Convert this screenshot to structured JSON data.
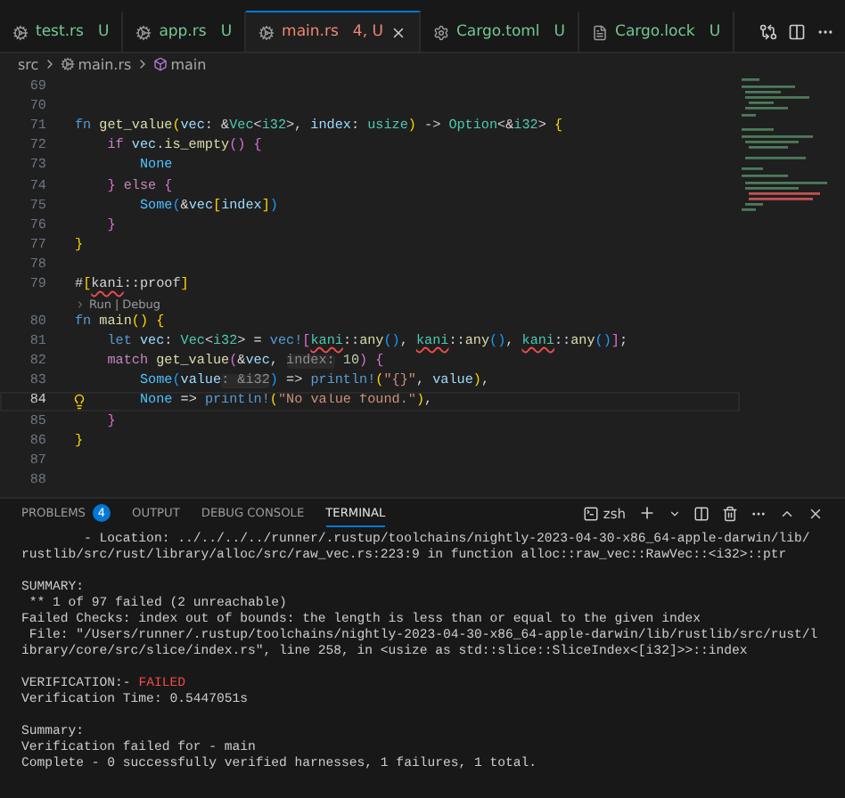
{
  "tabs": [
    {
      "label": "test.rs",
      "kind": "rust",
      "badge": "U",
      "color": "#73c991",
      "selected": false
    },
    {
      "label": "app.rs",
      "kind": "rust",
      "badge": "U",
      "color": "#73c991",
      "selected": false
    },
    {
      "label": "main.rs",
      "kind": "rust",
      "badge": "4, U",
      "color": "#f48771",
      "selected": true
    },
    {
      "label": "Cargo.toml",
      "kind": "config",
      "badge": "U",
      "color": "#73c991",
      "selected": false
    },
    {
      "label": "Cargo.lock",
      "kind": "lock",
      "badge": "U",
      "color": "#73c991",
      "selected": false
    }
  ],
  "breadcrumb": [
    {
      "label": "src",
      "kind": "folder"
    },
    {
      "label": "main.rs",
      "kind": "rust"
    },
    {
      "label": "main",
      "kind": "symbol"
    }
  ],
  "editor": {
    "lines": [
      {
        "kind": "code",
        "number": "69",
        "current": false,
        "lightbulb": false
      },
      {
        "kind": "code",
        "number": "70",
        "current": false,
        "lightbulb": false
      },
      {
        "kind": "code",
        "number": "71",
        "current": false,
        "lightbulb": false,
        "tokens": [
          {
            "text": "fn ",
            "kind": "kw"
          },
          {
            "text": "get_value",
            "kind": "func"
          },
          {
            "text": "(",
            "kind": "br1"
          },
          {
            "text": "vec",
            "kind": "var"
          },
          {
            "text": ": &",
            "kind": "punct"
          },
          {
            "text": "Vec",
            "kind": "type"
          },
          {
            "text": "<",
            "kind": "punct"
          },
          {
            "text": "i32",
            "kind": "type"
          },
          {
            "text": ">, ",
            "kind": "punct"
          },
          {
            "text": "index",
            "kind": "var"
          },
          {
            "text": ": ",
            "kind": "punct"
          },
          {
            "text": "usize",
            "kind": "type"
          },
          {
            "text": ")",
            "kind": "br1"
          },
          {
            "text": " -> ",
            "kind": "punct"
          },
          {
            "text": "Option",
            "kind": "type"
          },
          {
            "text": "<&",
            "kind": "punct"
          },
          {
            "text": "i32",
            "kind": "type"
          },
          {
            "text": "> ",
            "kind": "punct"
          },
          {
            "text": "{",
            "kind": "br1"
          }
        ]
      },
      {
        "kind": "code",
        "number": "72",
        "current": false,
        "lightbulb": false,
        "tokens": [
          {
            "text": "    if ",
            "kind": "ctrl"
          },
          {
            "text": "vec",
            "kind": "var"
          },
          {
            "text": ".",
            "kind": "punct"
          },
          {
            "text": "is_empty",
            "kind": "func"
          },
          {
            "text": "()",
            "kind": "br2"
          },
          {
            "text": " {",
            "kind": "br2"
          }
        ]
      },
      {
        "kind": "code",
        "number": "73",
        "current": false,
        "lightbulb": false,
        "tokens": [
          {
            "text": "        None",
            "kind": "enum"
          }
        ]
      },
      {
        "kind": "code",
        "number": "74",
        "current": false,
        "lightbulb": false,
        "tokens": [
          {
            "text": "    } ",
            "kind": "br2"
          },
          {
            "text": "else ",
            "kind": "ctrl"
          },
          {
            "text": "{",
            "kind": "br2"
          }
        ]
      },
      {
        "kind": "code",
        "number": "75",
        "current": false,
        "lightbulb": false,
        "tokens": [
          {
            "text": "        Some",
            "kind": "enum"
          },
          {
            "text": "(",
            "kind": "br3"
          },
          {
            "text": "&",
            "kind": "punct"
          },
          {
            "text": "vec",
            "kind": "var"
          },
          {
            "text": "[",
            "kind": "br1"
          },
          {
            "text": "index",
            "kind": "var"
          },
          {
            "text": "]",
            "kind": "br1"
          },
          {
            "text": ")",
            "kind": "br3"
          }
        ]
      },
      {
        "kind": "code",
        "number": "76",
        "current": false,
        "lightbulb": false,
        "tokens": [
          {
            "text": "    }",
            "kind": "br2"
          }
        ]
      },
      {
        "kind": "code",
        "number": "77",
        "current": false,
        "lightbulb": false,
        "tokens": [
          {
            "text": "}",
            "kind": "br1"
          }
        ]
      },
      {
        "kind": "code",
        "number": "78",
        "current": false,
        "lightbulb": false
      },
      {
        "kind": "code",
        "number": "79",
        "current": false,
        "lightbulb": false,
        "tokens": [
          {
            "text": "#",
            "kind": "punct"
          },
          {
            "text": "[",
            "kind": "br1"
          },
          {
            "text": "kani",
            "kind": "punct",
            "squiggle": true
          },
          {
            "text": "::proof",
            "kind": "punct"
          },
          {
            "text": "]",
            "kind": "br1"
          }
        ]
      },
      {
        "kind": "codelens",
        "links": [
          "Run",
          "Debug"
        ],
        "separator": "|"
      },
      {
        "kind": "code",
        "number": "80",
        "current": false,
        "lightbulb": false,
        "tokens": [
          {
            "text": "fn ",
            "kind": "kw"
          },
          {
            "text": "main",
            "kind": "func"
          },
          {
            "text": "()",
            "kind": "br1"
          },
          {
            "text": " {",
            "kind": "br1"
          }
        ]
      },
      {
        "kind": "code",
        "number": "81",
        "current": false,
        "lightbulb": false,
        "tokens": [
          {
            "text": "    let ",
            "kind": "kw"
          },
          {
            "text": "vec",
            "kind": "var"
          },
          {
            "text": ": ",
            "kind": "punct"
          },
          {
            "text": "Vec",
            "kind": "type"
          },
          {
            "text": "<",
            "kind": "punct"
          },
          {
            "text": "i32",
            "kind": "type"
          },
          {
            "text": "> = ",
            "kind": "punct"
          },
          {
            "text": "vec!",
            "kind": "macro"
          },
          {
            "text": "[",
            "kind": "br2"
          },
          {
            "text": "kani",
            "kind": "type",
            "squiggle": true
          },
          {
            "text": "::",
            "kind": "punct"
          },
          {
            "text": "any",
            "kind": "func"
          },
          {
            "text": "()",
            "kind": "br3"
          },
          {
            "text": ", ",
            "kind": "punct"
          },
          {
            "text": "kani",
            "kind": "type",
            "squiggle": true
          },
          {
            "text": "::",
            "kind": "punct"
          },
          {
            "text": "any",
            "kind": "func"
          },
          {
            "text": "()",
            "kind": "br3"
          },
          {
            "text": ", ",
            "kind": "punct"
          },
          {
            "text": "kani",
            "kind": "type",
            "squiggle": true
          },
          {
            "text": "::",
            "kind": "punct"
          },
          {
            "text": "any",
            "kind": "func"
          },
          {
            "text": "()",
            "kind": "br3"
          },
          {
            "text": "]",
            "kind": "br2"
          },
          {
            "text": ";",
            "kind": "punct"
          }
        ]
      },
      {
        "kind": "code",
        "number": "82",
        "current": false,
        "lightbulb": false,
        "tokens": [
          {
            "text": "    match ",
            "kind": "ctrl"
          },
          {
            "text": "get_value",
            "kind": "func"
          },
          {
            "text": "(",
            "kind": "br2"
          },
          {
            "text": "&",
            "kind": "punct"
          },
          {
            "text": "vec",
            "kind": "var"
          },
          {
            "text": ", ",
            "kind": "punct"
          },
          {
            "text": "index:",
            "kind": "hint"
          },
          {
            "text": " 10",
            "kind": "num"
          },
          {
            "text": ")",
            "kind": "br2"
          },
          {
            "text": " {",
            "kind": "br2"
          }
        ]
      },
      {
        "kind": "code",
        "number": "83",
        "current": false,
        "lightbulb": false,
        "tokens": [
          {
            "text": "        Some",
            "kind": "enum"
          },
          {
            "text": "(",
            "kind": "br3"
          },
          {
            "text": "value",
            "kind": "var"
          },
          {
            "text": ": &i32",
            "kind": "hint"
          },
          {
            "text": ")",
            "kind": "br3"
          },
          {
            "text": " => ",
            "kind": "punct"
          },
          {
            "text": "println!",
            "kind": "macro"
          },
          {
            "text": "(",
            "kind": "br1"
          },
          {
            "text": "\"{}\"",
            "kind": "str"
          },
          {
            "text": ", ",
            "kind": "punct"
          },
          {
            "text": "value",
            "kind": "var"
          },
          {
            "text": ")",
            "kind": "br1"
          },
          {
            "text": ",",
            "kind": "punct"
          }
        ]
      },
      {
        "kind": "code",
        "number": "84",
        "current": true,
        "lightbulb": true,
        "tokens": [
          {
            "text": "        None",
            "kind": "enum"
          },
          {
            "text": " => ",
            "kind": "punct"
          },
          {
            "text": "println!",
            "kind": "macro"
          },
          {
            "text": "(",
            "kind": "br1"
          },
          {
            "text": "\"No value found.\"",
            "kind": "str"
          },
          {
            "text": ")",
            "kind": "br1"
          },
          {
            "text": ",",
            "kind": "punct"
          }
        ]
      },
      {
        "kind": "code",
        "number": "85",
        "current": false,
        "lightbulb": false,
        "tokens": [
          {
            "text": "    }",
            "kind": "br2"
          }
        ]
      },
      {
        "kind": "code",
        "number": "86",
        "current": false,
        "lightbulb": false,
        "tokens": [
          {
            "text": "}",
            "kind": "br1"
          }
        ]
      },
      {
        "kind": "code",
        "number": "87",
        "current": false,
        "lightbulb": false
      },
      {
        "kind": "code",
        "number": "88",
        "current": false,
        "lightbulb": false
      }
    ]
  },
  "panel": {
    "tabs": [
      {
        "label": "PROBLEMS",
        "badge": "4",
        "selected": false
      },
      {
        "label": "OUTPUT",
        "selected": false
      },
      {
        "label": "DEBUG CONSOLE",
        "selected": false
      },
      {
        "label": "TERMINAL",
        "selected": true
      }
    ],
    "shell": "zsh"
  },
  "terminal": {
    "blocks": [
      {
        "lines": [
          {
            "text": "        - Location: ../../../../runner/.rustup/toolchains/nightly-2023-04-30-x86_64-apple-darwin/lib/"
          },
          {
            "text": "rustlib/src/rust/library/alloc/src/raw_vec.rs:223:9 in function alloc::raw_vec::RawVec::<i32>::ptr"
          }
        ]
      },
      {
        "lines": [
          {
            "text": "SUMMARY:"
          },
          {
            "text": " ** 1 of 97 failed (2 unreachable)"
          },
          {
            "text": "Failed Checks: index out of bounds: the length is less than or equal to the given index"
          },
          {
            "text": " File: \"/Users/runner/.rustup/toolchains/nightly-2023-04-30-x86_64-apple-darwin/lib/rustlib/src/rust/l"
          },
          {
            "text": "ibrary/core/src/slice/index.rs\", line 258, in <usize as std::slice::SliceIndex<[i32]>>::index"
          }
        ]
      },
      {
        "lines": [
          {
            "text": "VERIFICATION:- ",
            "result": {
              "text": "FAILED",
              "kind": "fail"
            }
          },
          {
            "text": "Verification Time: 0.5447051s"
          }
        ]
      },
      {
        "lines": [
          {
            "text": "Summary:"
          },
          {
            "text": "Verification failed for - main"
          },
          {
            "text": "Complete - 0 successfully verified harnesses, 1 failures, 1 total."
          }
        ]
      }
    ]
  }
}
